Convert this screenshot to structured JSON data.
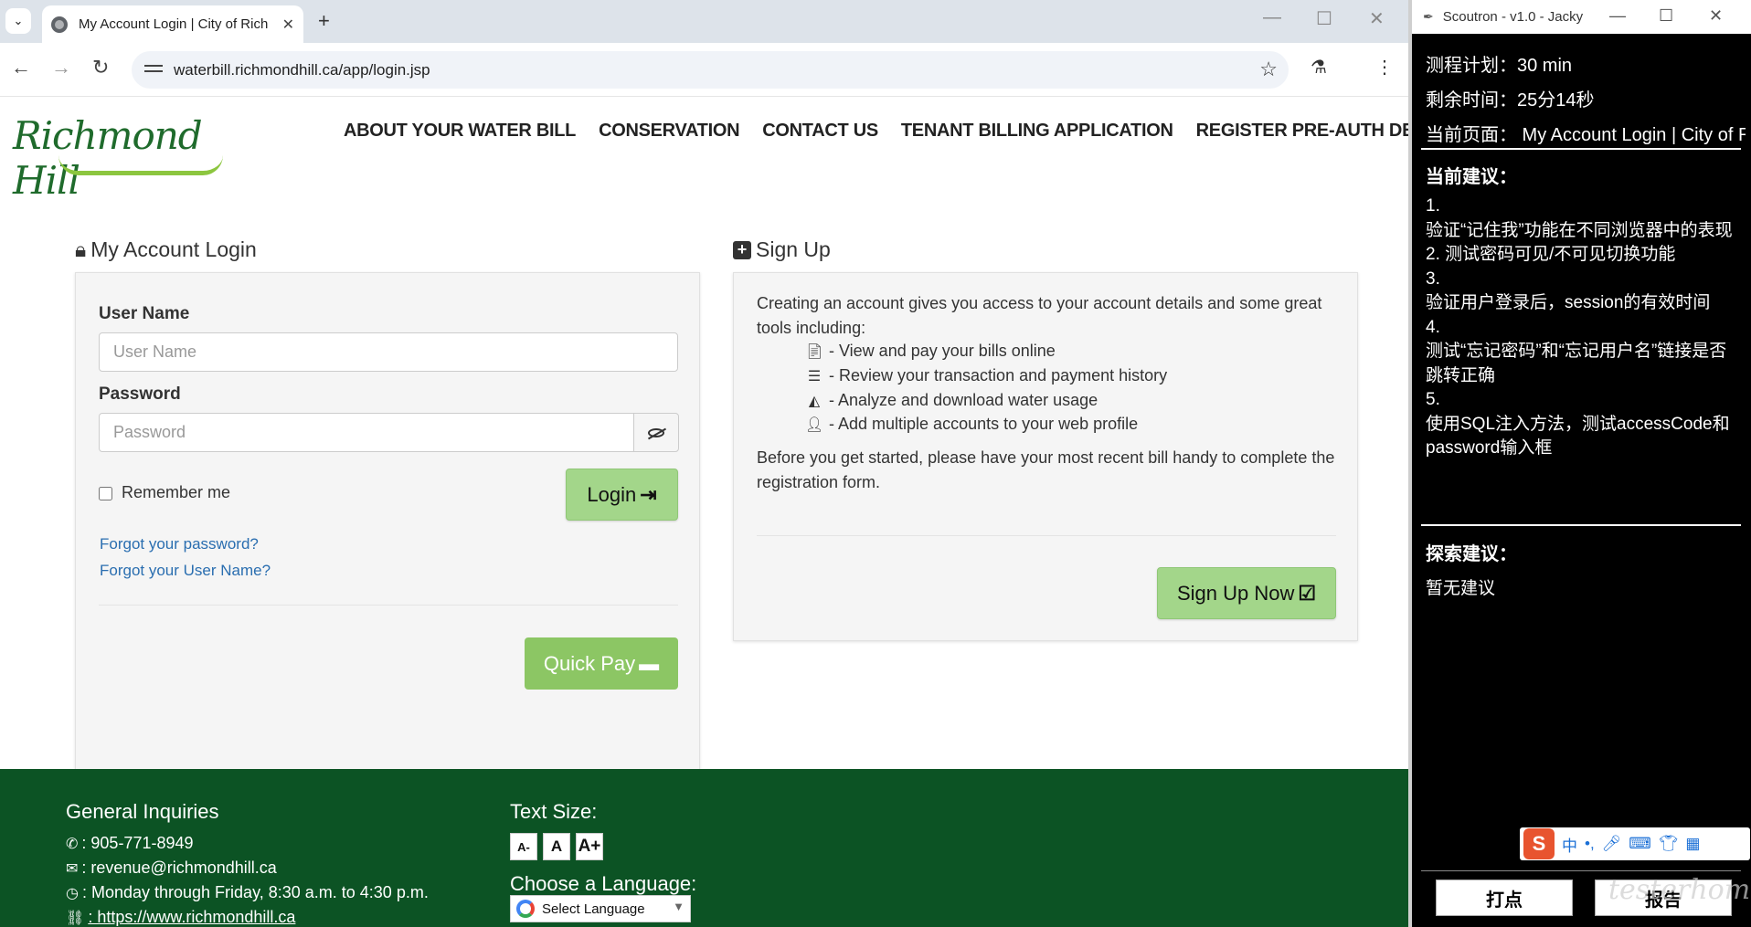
{
  "browser": {
    "tab_title": "My Account Login | City of Rich",
    "url": "waterbill.richmondhill.ca/app/login.jsp"
  },
  "site": {
    "logo_text": "Richmond Hill",
    "nav": [
      "ABOUT YOUR WATER BILL",
      "CONSERVATION",
      "CONTACT US",
      "TENANT BILLING APPLICATION",
      "REGISTER PRE-AUTH DEBIT"
    ]
  },
  "login": {
    "heading": "My Account Login",
    "username_label": "User Name",
    "username_placeholder": "User Name",
    "password_label": "Password",
    "password_placeholder": "Password",
    "remember_label": "Remember me",
    "login_button": "Login",
    "forgot_password": "Forgot your password?",
    "forgot_username": "Forgot your User Name?",
    "quick_pay_button": "Quick Pay"
  },
  "signup": {
    "heading": "Sign Up",
    "intro": "Creating an account gives you access to your account details and some great tools including:",
    "features": [
      {
        "icon": "pdf-icon",
        "text": "- View and pay your bills online"
      },
      {
        "icon": "list-icon",
        "text": "- Review your transaction and payment history"
      },
      {
        "icon": "area-chart-icon",
        "text": "- Analyze and download water usage"
      },
      {
        "icon": "user-icon",
        "text": "- Add multiple accounts to your web profile"
      }
    ],
    "outro": "Before you get started, please have your most recent bill handy to complete the registration form.",
    "button": "Sign Up Now"
  },
  "footer": {
    "inquiries_heading": "General Inquiries",
    "phone": ": 905-771-8949",
    "email": ": revenue@richmondhill.ca",
    "hours": ": Monday through Friday, 8:30 a.m. to 4:30 p.m.",
    "website": ": https://www.richmondhill.ca",
    "text_size_heading": "Text Size:",
    "text_size_buttons": [
      "A-",
      "A",
      "A+"
    ],
    "language_heading": "Choose a Language:",
    "language_select": "Select Language"
  },
  "scoutron": {
    "title": "Scoutron - v1.0 - Jacky",
    "plan": "测程计划：30 min",
    "remaining": "剩余时间：25分14秒",
    "current_page": "当前页面：  My Account Login | City of Richmond Hill",
    "current_suggestions_heading": "当前建议：",
    "suggestions": [
      "1.",
      "验证“记住我”功能在不同浏览器中的表现",
      "2.  测试密码可见/不可见切换功能",
      "3.",
      "验证用户登录后，session的有效时间",
      "4.",
      "测试“忘记密码”和“忘记用户名”链接是否跳转正确",
      "5.",
      "使用SQL注入方法，测试accessCode和password输入框"
    ],
    "explore_heading": "探索建议：",
    "explore_text": "暂无建议",
    "ime_label": "中",
    "dot_button": "打点",
    "report_button": "报告",
    "watermark": "testerhome.com"
  }
}
